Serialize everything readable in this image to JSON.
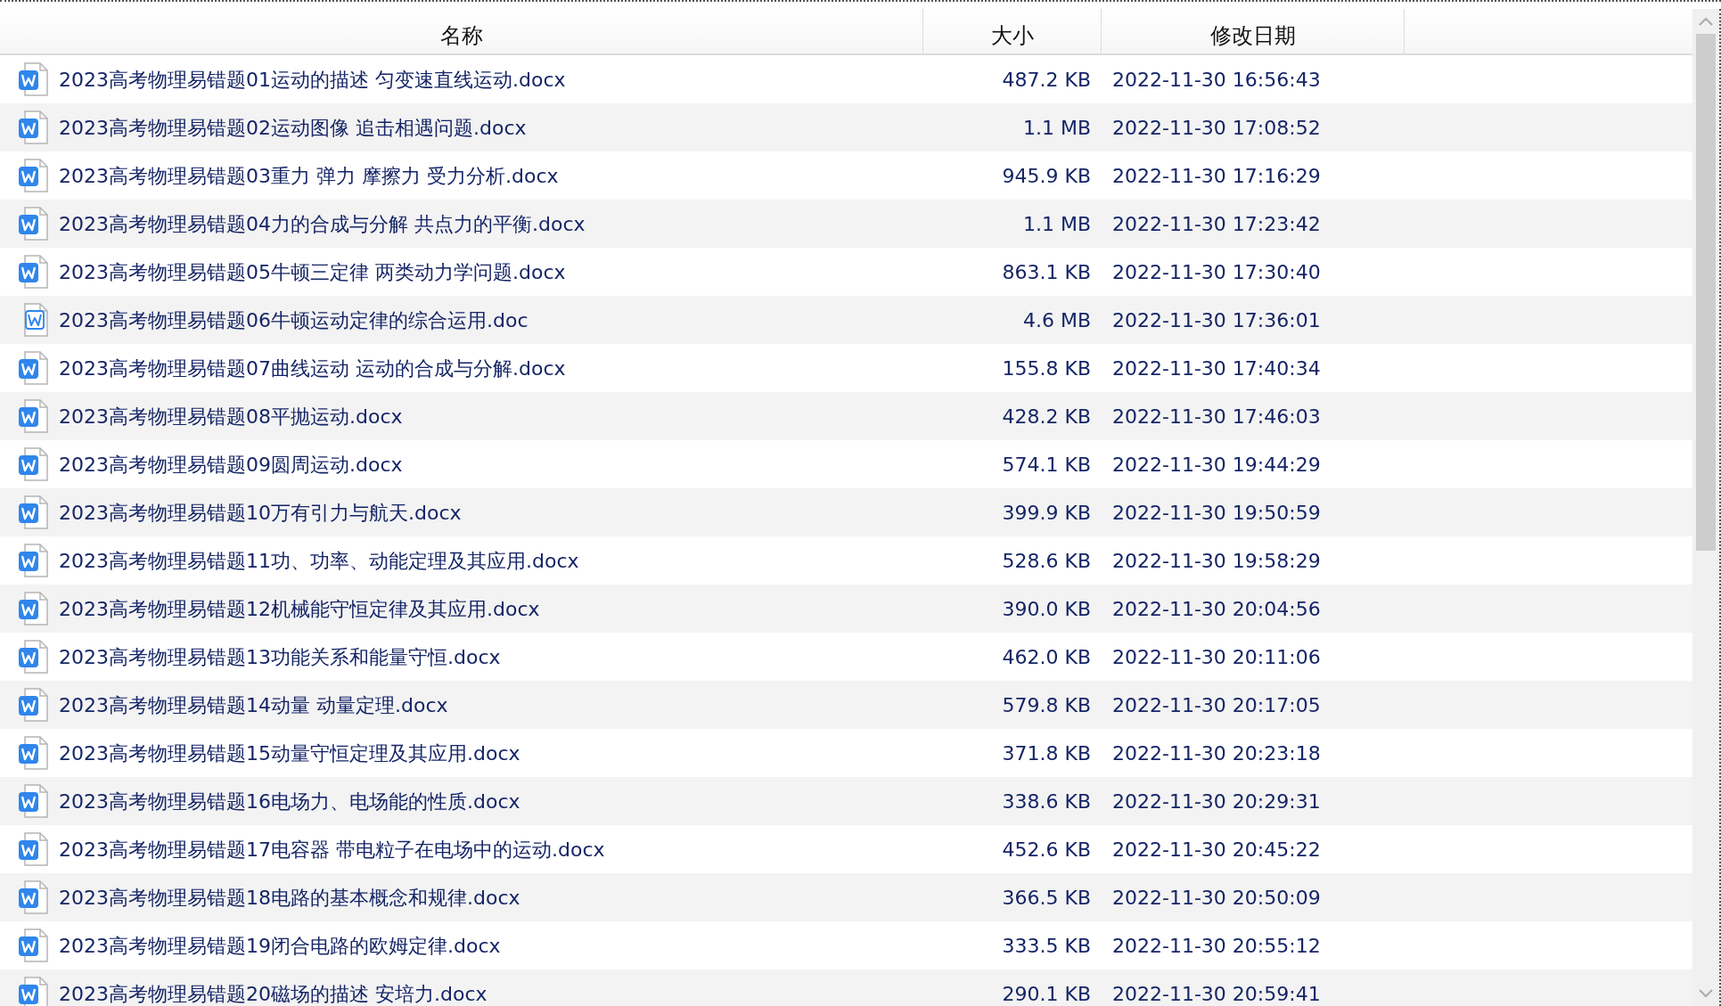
{
  "columns": [
    "名称",
    "大小",
    "修改日期"
  ],
  "files": [
    {
      "kind": "docx",
      "name": "2023高考物理易错题01运动的描述 匀变速直线运动.docx",
      "size": "487.2 KB",
      "modified": "2022-11-30 16:56:43"
    },
    {
      "kind": "docx",
      "name": "2023高考物理易错题02运动图像 追击相遇问题.docx",
      "size": "1.1 MB",
      "modified": "2022-11-30 17:08:52"
    },
    {
      "kind": "docx",
      "name": "2023高考物理易错题03重力 弹力 摩擦力 受力分析.docx",
      "size": "945.9 KB",
      "modified": "2022-11-30 17:16:29"
    },
    {
      "kind": "docx",
      "name": "2023高考物理易错题04力的合成与分解 共点力的平衡.docx",
      "size": "1.1 MB",
      "modified": "2022-11-30 17:23:42"
    },
    {
      "kind": "docx",
      "name": "2023高考物理易错题05牛顿三定律 两类动力学问题.docx",
      "size": "863.1 KB",
      "modified": "2022-11-30 17:30:40"
    },
    {
      "kind": "doc",
      "name": "2023高考物理易错题06牛顿运动定律的综合运用.doc",
      "size": "4.6 MB",
      "modified": "2022-11-30 17:36:01"
    },
    {
      "kind": "docx",
      "name": "2023高考物理易错题07曲线运动 运动的合成与分解.docx",
      "size": "155.8 KB",
      "modified": "2022-11-30 17:40:34"
    },
    {
      "kind": "docx",
      "name": "2023高考物理易错题08平抛运动.docx",
      "size": "428.2 KB",
      "modified": "2022-11-30 17:46:03"
    },
    {
      "kind": "docx",
      "name": "2023高考物理易错题09圆周运动.docx",
      "size": "574.1 KB",
      "modified": "2022-11-30 19:44:29"
    },
    {
      "kind": "docx",
      "name": "2023高考物理易错题10万有引力与航天.docx",
      "size": "399.9 KB",
      "modified": "2022-11-30 19:50:59"
    },
    {
      "kind": "docx",
      "name": "2023高考物理易错题11功、功率、动能定理及其应用.docx",
      "size": "528.6 KB",
      "modified": "2022-11-30 19:58:29"
    },
    {
      "kind": "docx",
      "name": "2023高考物理易错题12机械能守恒定律及其应用.docx",
      "size": "390.0 KB",
      "modified": "2022-11-30 20:04:56"
    },
    {
      "kind": "docx",
      "name": "2023高考物理易错题13功能关系和能量守恒.docx",
      "size": "462.0 KB",
      "modified": "2022-11-30 20:11:06"
    },
    {
      "kind": "docx",
      "name": "2023高考物理易错题14动量 动量定理.docx",
      "size": "579.8 KB",
      "modified": "2022-11-30 20:17:05"
    },
    {
      "kind": "docx",
      "name": "2023高考物理易错题15动量守恒定理及其应用.docx",
      "size": "371.8 KB",
      "modified": "2022-11-30 20:23:18"
    },
    {
      "kind": "docx",
      "name": "2023高考物理易错题16电场力、电场能的性质.docx",
      "size": "338.6 KB",
      "modified": "2022-11-30 20:29:31"
    },
    {
      "kind": "docx",
      "name": "2023高考物理易错题17电容器 带电粒子在电场中的运动.docx",
      "size": "452.6 KB",
      "modified": "2022-11-30 20:45:22"
    },
    {
      "kind": "docx",
      "name": "2023高考物理易错题18电路的基本概念和规律.docx",
      "size": "366.5 KB",
      "modified": "2022-11-30 20:50:09"
    },
    {
      "kind": "docx",
      "name": "2023高考物理易错题19闭合电路的欧姆定律.docx",
      "size": "333.5 KB",
      "modified": "2022-11-30 20:55:12"
    },
    {
      "kind": "docx",
      "name": "2023高考物理易错题20磁场的描述 安培力.docx",
      "size": "290.1 KB",
      "modified": "2022-11-30 20:59:41"
    }
  ]
}
